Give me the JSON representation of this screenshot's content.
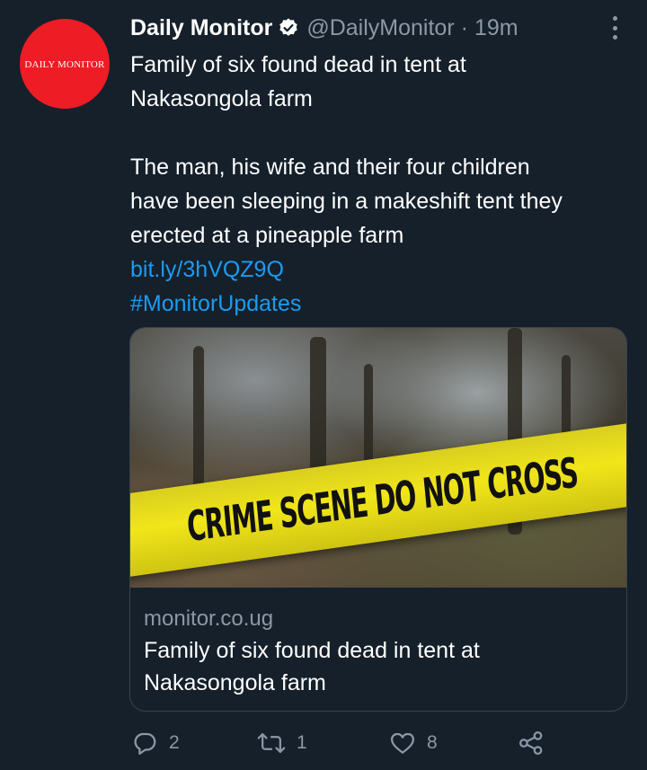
{
  "author": {
    "name": "Daily Monitor",
    "handle": "@DailyMonitor",
    "separator": "·",
    "time": "19m",
    "avatar_text": "DAILY MONITOR",
    "avatar_color": "#ee1c25"
  },
  "tweet": {
    "headline_line1": "Family of six found dead in tent at",
    "headline_line2": "Nakasongola farm",
    "body_line1": "The man, his wife and their four children",
    "body_line2": "have been sleeping in a makeshift tent they",
    "body_line3": "erected at a pineapple farm",
    "link": "bit.ly/3hVQZ9Q",
    "hashtag": "#MonitorUpdates"
  },
  "card": {
    "image_text": "CRIME SCENE   DO NOT CROSS",
    "domain": "monitor.co.ug",
    "title_line1": "Family of six found dead in tent at",
    "title_line2": "Nakasongola farm"
  },
  "actions": {
    "replies": "2",
    "retweets": "1",
    "likes": "8"
  },
  "icons": {
    "verified": "verified-badge-icon",
    "more": "more-options-icon",
    "reply": "reply-icon",
    "retweet": "retweet-icon",
    "like": "heart-icon",
    "share": "share-icon"
  },
  "colors": {
    "background": "#15202b",
    "link": "#1d9bf0",
    "secondary_text": "#8b98a5",
    "border": "#38444d",
    "tape": "#f1e61a"
  }
}
